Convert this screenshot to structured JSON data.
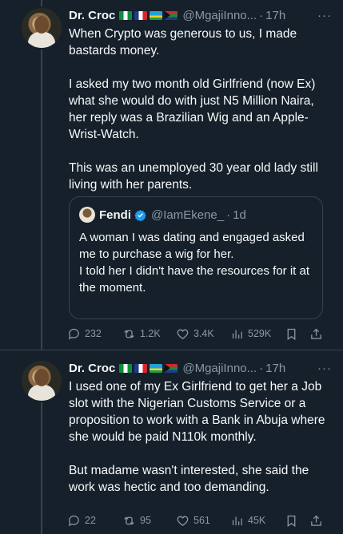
{
  "tweets": [
    {
      "author": {
        "name": "Dr. Croc",
        "flags": [
          "nigeria",
          "france",
          "rwanda",
          "south-africa"
        ],
        "handle": "@MgajiInno...",
        "time": "17h"
      },
      "more": "···",
      "text": "When Crypto was generous to us, I made bastards money.\n\nI asked my two month old Girlfriend (now Ex) what she would do with just N5 Million Naira, her reply was a Brazilian Wig and an Apple-Wrist-Watch.\n\nThis was an unemployed 30 year old lady still living with her parents.",
      "quote": {
        "name": "Fendi",
        "handle": "@IamEkene_",
        "time": "1d",
        "text": "A woman I was dating and engaged asked me to purchase a wig for her.\nI told her I didn't have the resources for it at the moment."
      },
      "stats": {
        "replies": "232",
        "retweets": "1.2K",
        "likes": "3.4K",
        "views": "529K"
      }
    },
    {
      "author": {
        "name": "Dr. Croc",
        "flags": [
          "nigeria",
          "france",
          "rwanda",
          "south-africa"
        ],
        "handle": "@MgajiInno...",
        "time": "17h"
      },
      "more": "···",
      "text": "I used one of my Ex Girlfriend to get her a Job slot with the Nigerian Customs Service or a proposition to work with a Bank in Abuja where she would be paid N110k monthly.\n\nBut madame wasn't interested, she said the work was hectic and too demanding.",
      "stats": {
        "replies": "22",
        "retweets": "95",
        "likes": "561",
        "views": "45K"
      }
    }
  ],
  "colors": {
    "background": "#15202b",
    "text": "#f7f9f9",
    "muted": "#8b98a5",
    "border": "#38444d",
    "verified": "#1d9bf0"
  }
}
